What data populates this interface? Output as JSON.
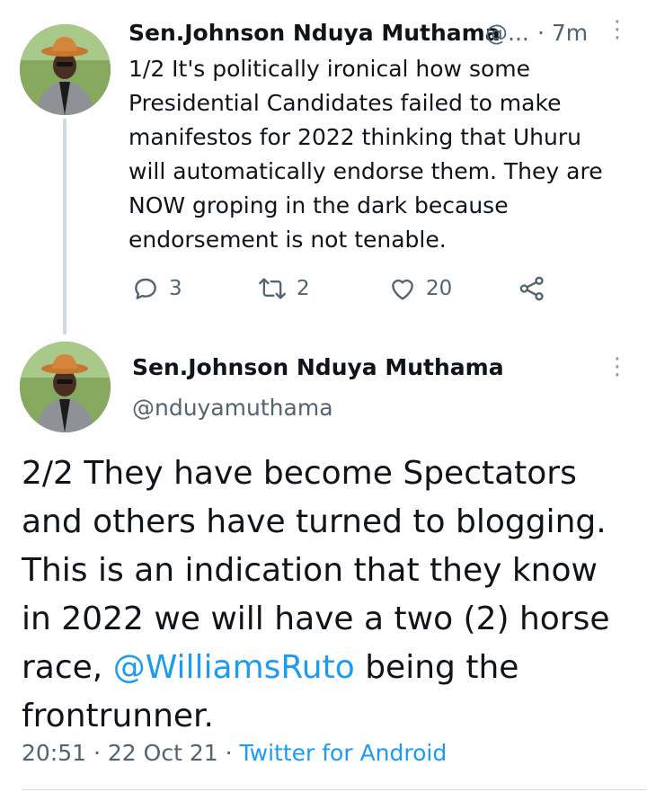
{
  "tweet1": {
    "name": "Sen.Johnson Nduya Muthama",
    "handle_truncated": "@...",
    "time": "· 7m",
    "more_icon": "⋮",
    "text": "1/2 It's politically ironical how some Presidential Candidates failed to make manifestos for 2022 thinking that Uhuru will automatically endorse them. They are NOW groping in the dark because endorsement is not tenable.",
    "replies": "3",
    "retweets": "2",
    "likes": "20"
  },
  "tweet2": {
    "name": "Sen.Johnson Nduya Muthama",
    "handle": "@nduyamuthama",
    "more_icon": "⋮",
    "text_before": "2/2 They have become Spectators and others have turned to blogging. This is an indication that they know in 2022 we will have a two (2) horse race, ",
    "mention": "@WilliamsRuto",
    "text_after": " being the frontrunner.",
    "time": "20:51",
    "date": "22 Oct 21",
    "source": "Twitter for Android",
    "separator": "·"
  },
  "colors": {
    "accent": "#1d9bf0",
    "secondary_text": "#536471",
    "primary_text": "#0f1419"
  }
}
